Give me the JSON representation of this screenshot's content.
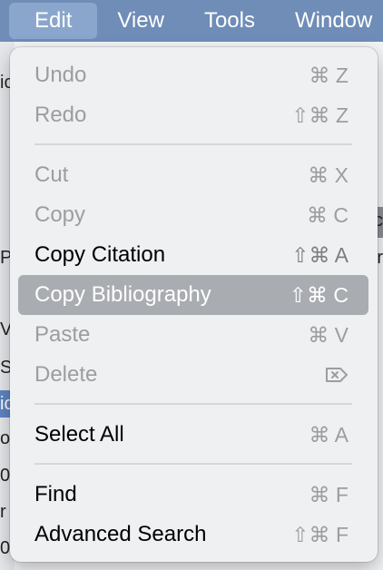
{
  "menubar": {
    "items": [
      {
        "label": "Edit"
      },
      {
        "label": "View"
      },
      {
        "label": "Tools"
      },
      {
        "label": "Window"
      }
    ]
  },
  "background_fragments": [
    "ic",
    "P",
    "V",
    "S",
    "ic",
    "o",
    "0",
    "r",
    "0",
    "c",
    "r"
  ],
  "edit_menu": {
    "items": [
      {
        "label": "Undo",
        "shortcut": "⌘ Z",
        "enabled": false
      },
      {
        "label": "Redo",
        "shortcut": "⇧⌘ Z",
        "enabled": false
      },
      {
        "label": "Cut",
        "shortcut": "⌘ X",
        "enabled": false
      },
      {
        "label": "Copy",
        "shortcut": "⌘ C",
        "enabled": false
      },
      {
        "label": "Copy Citation",
        "shortcut": "⇧⌘ A",
        "enabled": true
      },
      {
        "label": "Copy Bibliography",
        "shortcut": "⇧⌘ C",
        "enabled": true,
        "highlighted": true
      },
      {
        "label": "Paste",
        "shortcut": "⌘ V",
        "enabled": false
      },
      {
        "label": "Delete",
        "shortcut_icon": "delete-forward-key-icon",
        "enabled": false
      },
      {
        "label": "Select All",
        "shortcut": "⌘ A",
        "enabled": false
      },
      {
        "label": "Find",
        "shortcut": "⌘ F",
        "enabled": true
      },
      {
        "label": "Advanced Search",
        "shortcut": "⇧⌘ F",
        "enabled": true
      }
    ]
  },
  "colors": {
    "menubar_bg": "#6f8db7",
    "menu_bg": "#eff0f2",
    "highlight_bg": "#a9acb1",
    "disabled_text": "#9c9da1",
    "shortcut_enabled": "#7d7e82"
  }
}
